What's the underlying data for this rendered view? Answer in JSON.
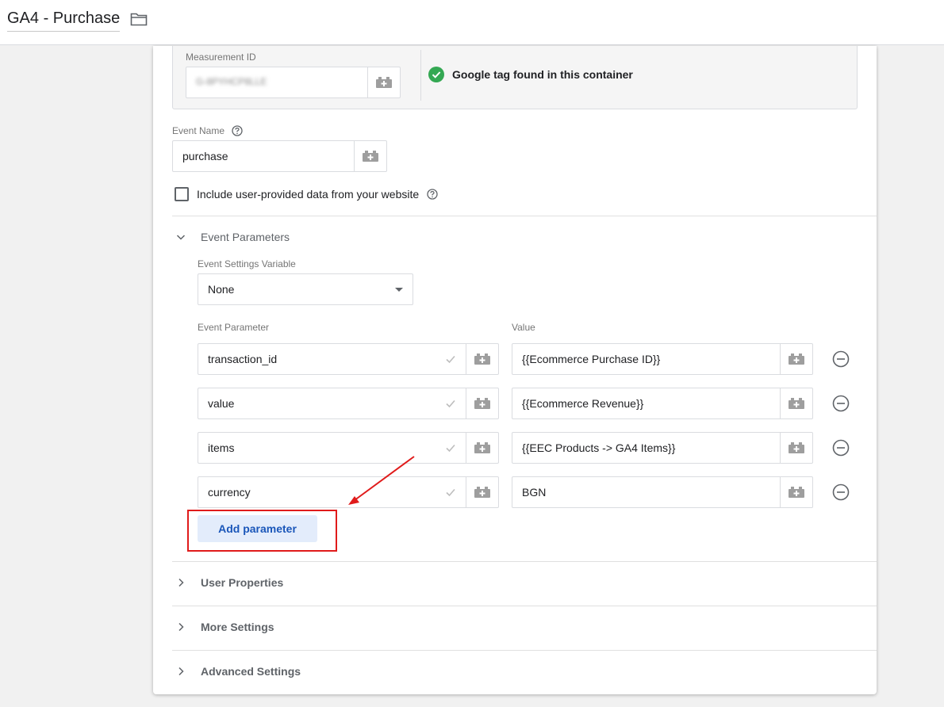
{
  "header": {
    "title": "GA4 - Purchase"
  },
  "measurement": {
    "label": "Measurement ID",
    "value_blurred": "G-8PYHCP8LLE",
    "status_text": "Google tag found in this container",
    "status_color": "#34a853"
  },
  "event_name": {
    "label": "Event Name",
    "value": "purchase"
  },
  "user_data_checkbox": {
    "label": "Include user-provided data from your website",
    "checked": false
  },
  "event_parameters": {
    "section_title": "Event Parameters",
    "settings_variable_label": "Event Settings Variable",
    "settings_variable_value": "None",
    "param_col_label": "Event Parameter",
    "value_col_label": "Value",
    "rows": [
      {
        "param": "transaction_id",
        "value": "{{Ecommerce Purchase ID}}"
      },
      {
        "param": "value",
        "value": "{{Ecommerce Revenue}}"
      },
      {
        "param": "items",
        "value": "{{EEC Products -> GA4 Items}}"
      },
      {
        "param": "currency",
        "value": "BGN"
      }
    ],
    "add_button": "Add parameter"
  },
  "sections": {
    "user_properties": "User Properties",
    "more_settings": "More Settings",
    "advanced_settings": "Advanced Settings"
  },
  "colors": {
    "annotation_red": "#e01b1b",
    "accent_blue": "#1a56b9"
  }
}
